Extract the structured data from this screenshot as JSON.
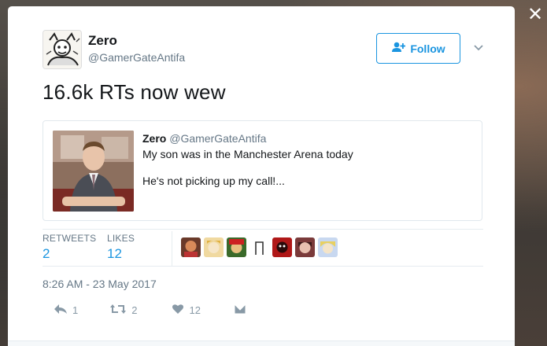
{
  "close_glyph": "✕",
  "author": {
    "display_name": "Zero",
    "screen_name": "@GamerGateAntifa"
  },
  "follow_button": {
    "label": "Follow",
    "icon": "add-user-icon",
    "color": "#1b95e0"
  },
  "tweet": {
    "text": "16.6k RTs now wew"
  },
  "quoted_tweet": {
    "display_name": "Zero",
    "screen_name": "@GamerGateAntifa",
    "line1": "My son was in the Manchester Arena today",
    "line2": "He's not picking up my call!..."
  },
  "stats": {
    "retweets_label": "RETWEETS",
    "retweets_count": "2",
    "likes_label": "LIKES",
    "likes_count": "12"
  },
  "likers_count_shown": 8,
  "timestamp": "8:26 AM - 23 May 2017",
  "actions": {
    "reply_count": "1",
    "retweet_count": "2",
    "like_count": "12"
  }
}
